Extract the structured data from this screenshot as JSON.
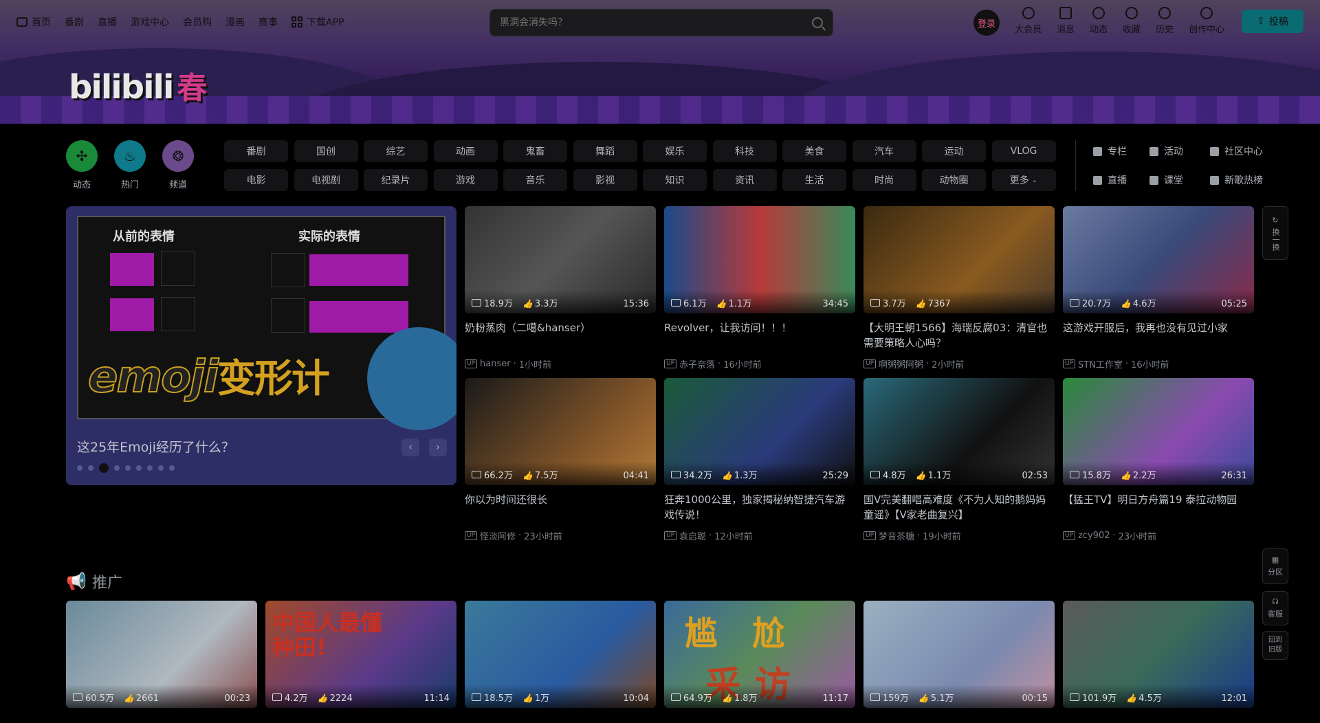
{
  "topnav": {
    "items": [
      "首页",
      "番剧",
      "直播",
      "游戏中心",
      "会员购",
      "漫画",
      "赛事",
      "下载APP"
    ]
  },
  "search": {
    "placeholder": "黑洞会消失吗？"
  },
  "user": {
    "login_label": "登录",
    "items": [
      "大会员",
      "消息",
      "动态",
      "收藏",
      "历史",
      "创作中心"
    ],
    "upload_label": "投稿"
  },
  "logo": {
    "text": "bilibili",
    "badge": "春"
  },
  "quick": {
    "items": [
      "动态",
      "热门",
      "频道"
    ]
  },
  "categories": [
    "番剧",
    "国创",
    "综艺",
    "动画",
    "鬼畜",
    "舞蹈",
    "娱乐",
    "科技",
    "美食",
    "汽车",
    "运动",
    "VLOG",
    "电影",
    "电视剧",
    "纪录片",
    "游戏",
    "音乐",
    "影视",
    "知识",
    "资讯",
    "生活",
    "时尚",
    "动物圈",
    "更多"
  ],
  "side_categories": [
    "专栏",
    "活动",
    "社区中心",
    "直播",
    "课堂",
    "新歌热榜"
  ],
  "carousel": {
    "title": "这25年Emoji经历了什么？",
    "left_heading": "从前的表情",
    "right_heading": "实际的表情",
    "big_text": "emoji",
    "big_text_cn": "变形计",
    "prev": "‹",
    "next": "›",
    "dot_count": 9,
    "active_dot": 2
  },
  "videos": [
    {
      "views": "18.9万",
      "likes": "3.3万",
      "duration": "15:36",
      "title": "奶粉蒸肉（二噶&hanser）",
      "author": "hanser",
      "time": "1小时前"
    },
    {
      "views": "6.1万",
      "likes": "1.1万",
      "duration": "34:45",
      "title": "Revolver，让我访问！！！",
      "author": "赤子奈落",
      "time": "16小时前"
    },
    {
      "views": "3.7万",
      "likes": "7367",
      "duration": "",
      "title": "【大明王朝1566】海瑞反腐03：清官也需要策略人心吗？",
      "author": "啊粥粥阿粥",
      "time": "2小时前"
    },
    {
      "views": "20.7万",
      "likes": "4.6万",
      "duration": "05:25",
      "title": "这游戏开服后，我再也没有见过小家",
      "author": "STN工作室",
      "time": "16小时前"
    },
    {
      "views": "66.2万",
      "likes": "7.5万",
      "duration": "04:41",
      "title": "你以为时间还很长",
      "author": "怪淡阿修",
      "time": "23小时前"
    },
    {
      "views": "34.2万",
      "likes": "1.3万",
      "duration": "25:29",
      "title": "狂奔1000公里，独家揭秘纳智捷汽车游戏传说！",
      "author": "袁启聪",
      "time": "12小时前"
    },
    {
      "views": "4.8万",
      "likes": "1.1万",
      "duration": "02:53",
      "title": "国V完美翻唱高难度《不为人知的鹅妈妈童谣》【V家老曲复兴】",
      "author": "梦音茶糖",
      "time": "19小时前"
    },
    {
      "views": "15.8万",
      "likes": "2.2万",
      "duration": "26:31",
      "title": "【猛王TV】明日方舟篇19 泰拉动物园",
      "author": "zcy902",
      "time": "23小时前"
    }
  ],
  "promo": {
    "title": "推广",
    "items": [
      {
        "views": "60.5万",
        "likes": "2661",
        "duration": "00:23"
      },
      {
        "views": "4.2万",
        "likes": "2224",
        "duration": "11:14"
      },
      {
        "views": "18.5万",
        "likes": "1万",
        "duration": "10:04"
      },
      {
        "views": "64.9万",
        "likes": "1.8万",
        "duration": "11:17"
      },
      {
        "views": "159万",
        "likes": "5.1万",
        "duration": "00:15"
      },
      {
        "views": "101.9万",
        "likes": "4.5万",
        "duration": "12:01"
      }
    ],
    "captions": [
      "中国人最懂种田!",
      "尴尬",
      "采访"
    ]
  },
  "float": {
    "refresh": "换一换",
    "zone": "分区",
    "service": "客服",
    "old": "回到旧版"
  }
}
